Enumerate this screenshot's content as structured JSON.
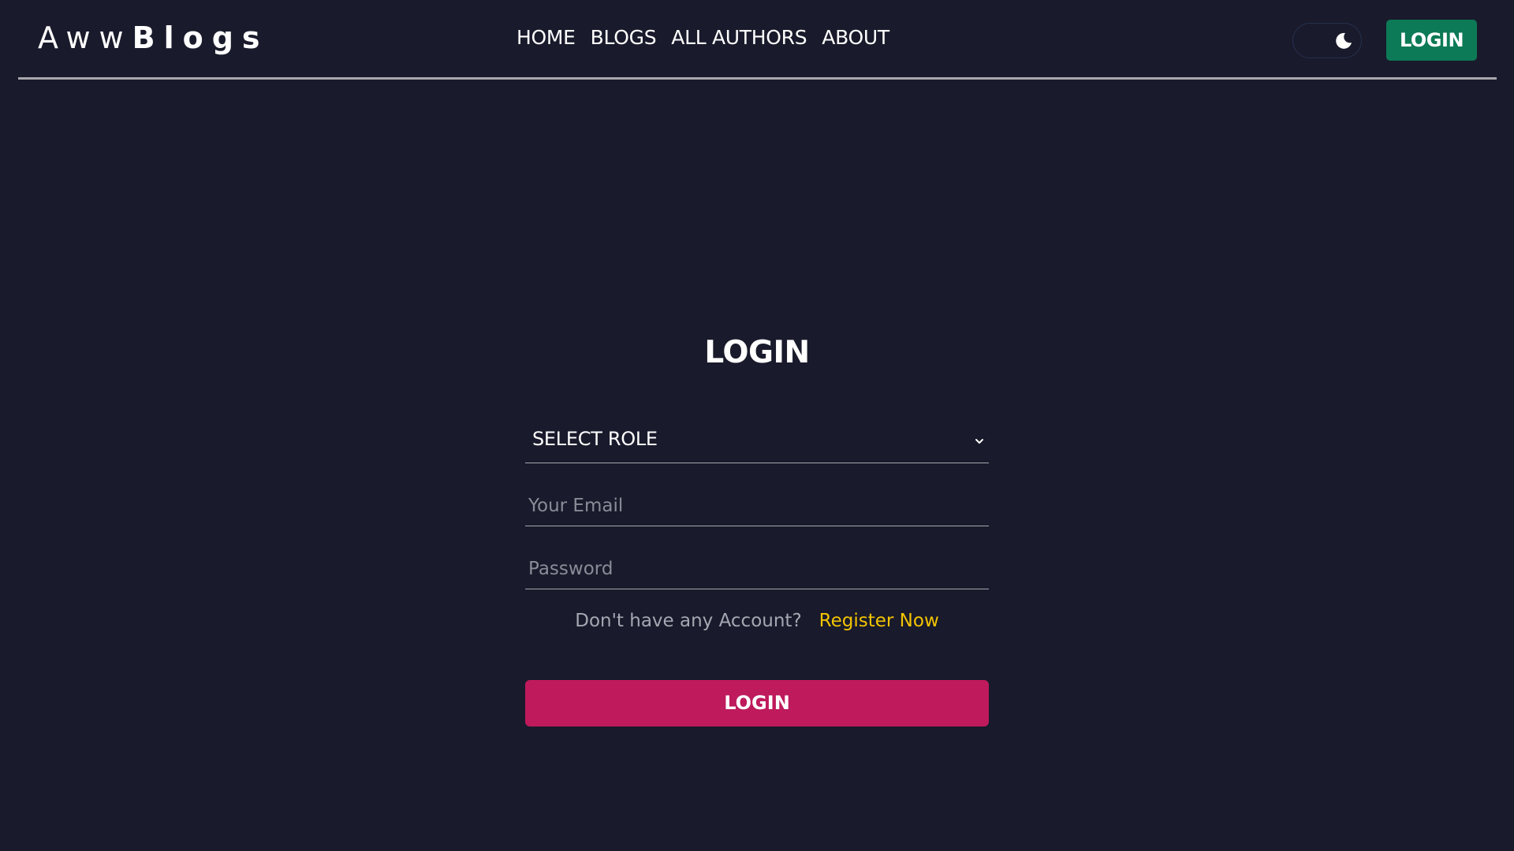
{
  "header": {
    "logo_light": "Aww",
    "logo_bold": "Blogs",
    "nav": [
      "HOME",
      "BLOGS",
      "ALL AUTHORS",
      "ABOUT"
    ],
    "theme_toggle_icon": "moon-icon",
    "login_label": "LOGIN"
  },
  "form": {
    "title": "LOGIN",
    "role_select": "SELECT ROLE",
    "email_placeholder": "Your Email",
    "password_placeholder": "Password",
    "no_account_text": "Don't have any Account?",
    "register_link": "Register Now",
    "submit_label": "LOGIN"
  },
  "colors": {
    "background": "#191a2b",
    "nav_login_button": "#0c7a56",
    "submit_button": "#be1a5c",
    "register_link": "#f4c400"
  }
}
